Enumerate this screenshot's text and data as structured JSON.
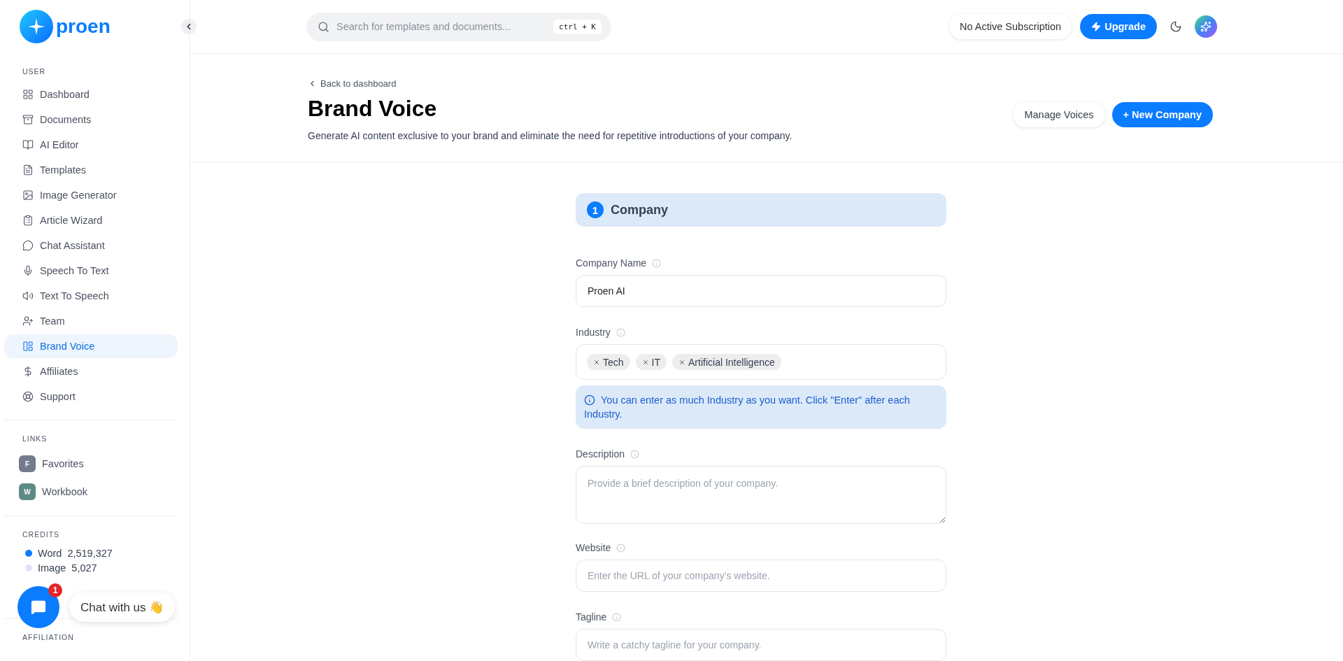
{
  "sidebar": {
    "logo": "proen",
    "sections": [
      {
        "title": "USER",
        "items": [
          {
            "label": "Dashboard",
            "selected": false
          },
          {
            "label": "Documents",
            "selected": false
          },
          {
            "label": "AI Editor",
            "selected": false
          },
          {
            "label": "Templates",
            "selected": false
          },
          {
            "label": "Image Generator",
            "selected": false
          },
          {
            "label": "Article Wizard",
            "selected": false
          },
          {
            "label": "Chat Assistant",
            "selected": false
          },
          {
            "label": "Speech To Text",
            "selected": false
          },
          {
            "label": "Text To Speech",
            "selected": false
          },
          {
            "label": "Team",
            "selected": false
          },
          {
            "label": "Brand Voice",
            "selected": true
          },
          {
            "label": "Affiliates",
            "selected": false
          },
          {
            "label": "Support",
            "selected": false
          }
        ]
      }
    ],
    "links_title": "LINKS",
    "links": [
      {
        "initial": "F",
        "label": "Favorites",
        "color": "#737b8c"
      },
      {
        "initial": "W",
        "label": "Workbook",
        "color": "#5e8a85"
      }
    ],
    "credits": {
      "title": "CREDITS",
      "items": [
        {
          "label": "Word",
          "value": "2,519,327",
          "color": "#0a7cff"
        },
        {
          "label": "Image",
          "value": "5,027",
          "color": "#dce6f1"
        }
      ]
    },
    "affiliation_title": "AFFILIATION"
  },
  "topbar": {
    "search": {
      "placeholder": "Search for templates and documents..."
    },
    "shortcut": "ctrl + K",
    "subscription": "No Active Subscription",
    "upgrade": "Upgrade"
  },
  "header": {
    "back": "Back to dashboard",
    "title": "Brand Voice",
    "subtitle": "Generate AI content exclusive to your brand and eliminate the need for repetitive introductions of your company.",
    "buttons": [
      {
        "label": "Manage Voices",
        "kind": "secondary"
      },
      {
        "label": "+ New Company",
        "kind": "primary"
      }
    ]
  },
  "form": {
    "step": {
      "number": "1",
      "title": "Company"
    },
    "fields": [
      {
        "kind": "text",
        "label": "Company Name",
        "value": "Proen AI"
      },
      {
        "kind": "tags",
        "label": "Industry",
        "tags": [
          "Tech",
          "IT",
          "Artificial Intelligence"
        ],
        "note": "You can enter as much Industry as you want. Click \"Enter\" after each Industry."
      },
      {
        "kind": "textarea",
        "label": "Description",
        "placeholder": "Provide a brief description of your company."
      },
      {
        "kind": "text",
        "label": "Website",
        "placeholder": "Enter the URL of your company’s website."
      },
      {
        "kind": "text",
        "label": "Tagline",
        "placeholder": "Write a catchy tagline for your company."
      }
    ]
  },
  "chat": {
    "label": "Chat with us 👋",
    "badge": "1"
  }
}
